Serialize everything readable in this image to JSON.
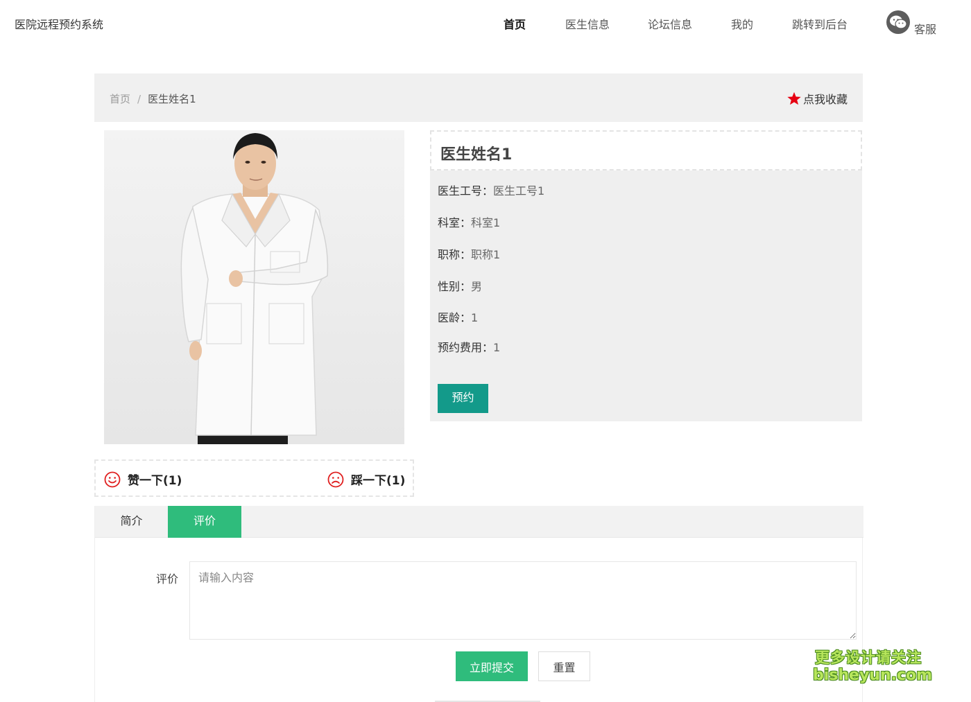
{
  "header": {
    "site_title": "医院远程预约系统",
    "nav": [
      {
        "label": "首页",
        "active": true
      },
      {
        "label": "医生信息",
        "active": false
      },
      {
        "label": "论坛信息",
        "active": false
      },
      {
        "label": "我的",
        "active": false
      },
      {
        "label": "跳转到后台",
        "active": false
      }
    ],
    "service_icon": "wechat-icon",
    "service_label": "客服"
  },
  "breadcrumb": {
    "home": "首页",
    "separator": "/",
    "current": "医生姓名1"
  },
  "favorite": {
    "icon": "star-icon",
    "label": "点我收藏",
    "color": "#e60012"
  },
  "doctor": {
    "name": "医生姓名1",
    "fields": [
      {
        "label": "医生工号：",
        "value": "医生工号1"
      },
      {
        "label": "科室：",
        "value": "科室1"
      },
      {
        "label": "职称：",
        "value": "职称1"
      },
      {
        "label": "性别：",
        "value": "男"
      },
      {
        "label": "医龄：",
        "value": "1"
      },
      {
        "label": "预约费用：",
        "value": "1"
      }
    ],
    "book_label": "预约",
    "book_color": "#139a8a"
  },
  "votes": {
    "like_icon": "smile-icon",
    "like_label": "赞一下(1)",
    "dislike_icon": "frown-icon",
    "dislike_label": "踩一下(1)",
    "icon_color": "#e02020"
  },
  "tabs": [
    {
      "label": "简介",
      "active": false
    },
    {
      "label": "评价",
      "active": true
    }
  ],
  "review_form": {
    "label": "评价",
    "placeholder": "请输入内容",
    "value": "",
    "submit_label": "立即提交",
    "reset_label": "重置",
    "accent": "#2fbc7c"
  },
  "watermark": {
    "line1": "更多设计请关注",
    "line2": "bisheyun.com"
  }
}
